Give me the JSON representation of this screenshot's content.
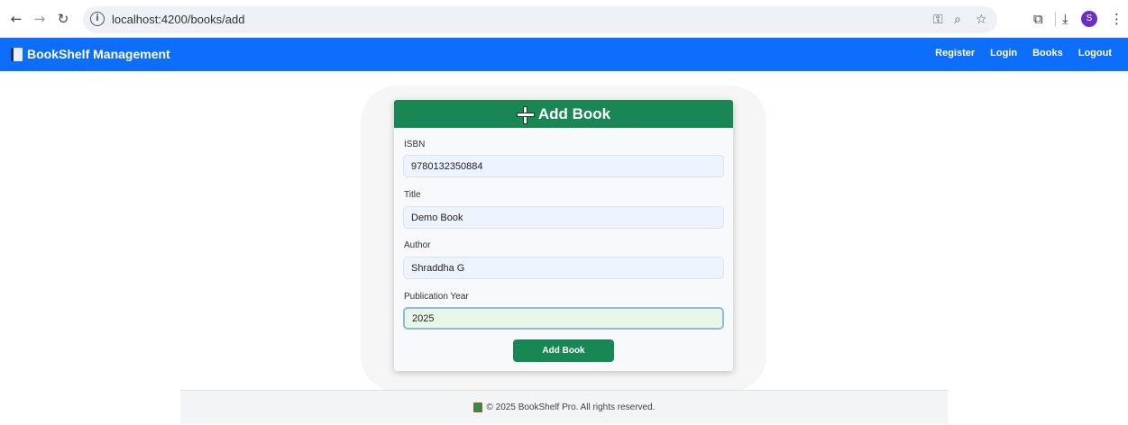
{
  "browser": {
    "url": "localhost:4200/books/add",
    "info_glyph": "i",
    "profile_initial": "S"
  },
  "navbar": {
    "brand": "BookShelf Management",
    "links": [
      "Register",
      "Login",
      "Books",
      "Logout"
    ]
  },
  "card": {
    "title": "Add Book",
    "fields": [
      {
        "label": "ISBN",
        "value": "9780132350884"
      },
      {
        "label": "Title",
        "value": "Demo Book"
      },
      {
        "label": "Author",
        "value": "Shraddha G"
      },
      {
        "label": "Publication Year",
        "value": "2025"
      }
    ],
    "submit_label": "Add Book"
  },
  "footer": {
    "text": "© 2025 BookShelf Pro. All rights reserved."
  },
  "colors": {
    "navbar": "#0d6efd",
    "card_header": "#198754",
    "submit_button": "#198754"
  }
}
